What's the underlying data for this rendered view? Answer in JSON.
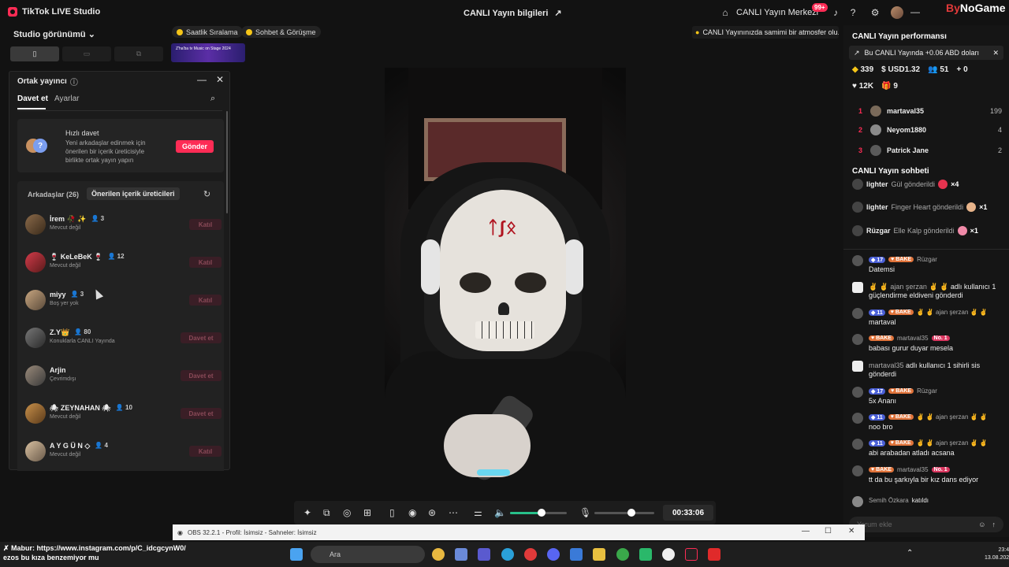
{
  "app": {
    "title": "TikTok LIVE Studio",
    "center_title": "CANLI Yayın bilgileri",
    "live_center": "CANLI Yayın Merkezi",
    "notif_badge": "99+"
  },
  "watermark": {
    "brand_by": "By",
    "brand_rest": "NoGame"
  },
  "studio": {
    "view_label": "Studio görünümü"
  },
  "pills": {
    "hourly": "Saatlik Sıralama",
    "chat": "Sohbet & Görüşme"
  },
  "banner": {
    "text": "Z'ha'ba tv Music on Stage 2024"
  },
  "tip": {
    "text": "CANLI Yayınınızda samimi bir atmosfer olu..."
  },
  "cohost": {
    "title": "Ortak yayıncı",
    "tabs": [
      "Davet et",
      "Ayarlar"
    ],
    "quick": {
      "title": "Hızlı davet",
      "desc": "Yeni arkadaşlar edinmek için önerilen bir içerik üreticisiyle birlikte ortak yayın yapın",
      "button": "Gönder"
    },
    "friends_tab": "Arkadaşlar (26)",
    "suggested_tab": "Önerilen içerik üreticileri",
    "rows": [
      {
        "name": "İrem 🥀 ✨",
        "count": "3",
        "status": "Mevcut değil",
        "button": "Katıl"
      },
      {
        "name": "🍷 KeLeBeK 🍷",
        "count": "12",
        "status": "Mevcut değil",
        "button": "Katıl"
      },
      {
        "name": "miyy",
        "count": "3",
        "status": "Boş yer yok",
        "button": "Katıl"
      },
      {
        "name": "Z.Y👑",
        "count": "80",
        "status": "Konuklarla CANLI Yayında",
        "button": "Davet et"
      },
      {
        "name": "Arjin",
        "count": "",
        "status": "Çevrimdışı",
        "button": "Davet et"
      },
      {
        "name": "🕷 ZEYNAHAN 🕷",
        "count": "10",
        "status": "Mevcut değil",
        "button": "Davet et"
      },
      {
        "name": "A Y G Ü N ◇",
        "count": "4",
        "status": "Mevcut değil",
        "button": "Katıl"
      }
    ]
  },
  "toolbar": {
    "timer": "00:33:06",
    "volume": 0.55,
    "mic": 0.62
  },
  "performance": {
    "title": "CANLI Yayın performansı",
    "earnings": "Bu CANLI Yayında +0.06 ABD doları",
    "coins": "339",
    "usd": "USD1.32",
    "viewers": "51",
    "new": "0",
    "likes": "12K",
    "gifts": "9",
    "ranks": [
      {
        "rank": "1",
        "name": "martaval35",
        "value": "199"
      },
      {
        "rank": "2",
        "name": "Neyom1880",
        "value": "4"
      },
      {
        "rank": "3",
        "name": "Patrick Jane",
        "value": "2"
      }
    ]
  },
  "chat": {
    "title": "CANLI Yayın sohbeti",
    "gifts": [
      {
        "user": "lighter",
        "text": "Gül gönderildi",
        "mult": "×4",
        "color": "#e5334f"
      },
      {
        "user": "lighter",
        "text": "Finger Heart gönderildi",
        "mult": "×1",
        "color": "#e8b48a"
      },
      {
        "user": "Rüzgar",
        "text": "Elle Kalp gönderildi",
        "mult": "×1",
        "color": "#f08aa8"
      }
    ],
    "messages": [
      {
        "lvl": "17",
        "bake": "BAKE",
        "user": "Rüzgar",
        "text": "Datemsi"
      },
      {
        "lvl": "",
        "bake": "",
        "user": "✌ ✌ ajan şerzan ✌ ✌",
        "text": "adlı kullanıcı 1 güçlendirme eldiveni gönderdi"
      },
      {
        "lvl": "11",
        "bake": "BAKE",
        "user": "✌ ✌ ajan şerzan ✌ ✌",
        "text": "martaval"
      },
      {
        "lvl": "",
        "bake": "BAKE",
        "user": "martaval35",
        "no1": "No. 1",
        "text": "babası gurur duyar mesela"
      },
      {
        "lvl": "",
        "bake": "",
        "user": "martaval35",
        "text": "adlı kullanıcı 1 sihirli sis gönderdi"
      },
      {
        "lvl": "17",
        "bake": "BAKE",
        "user": "Rüzgar",
        "text": "5x Ananı"
      },
      {
        "lvl": "11",
        "bake": "BAKE",
        "user": "✌ ✌ ajan şerzan ✌ ✌",
        "text": "noo bro"
      },
      {
        "lvl": "11",
        "bake": "BAKE",
        "user": "✌ ✌ ajan şerzan ✌ ✌",
        "text": "abi arabadan atladı acsana"
      },
      {
        "lvl": "",
        "bake": "BAKE",
        "user": "martaval35",
        "no1": "No. 1",
        "text": "tt da bu şarkıyla bir kız dans ediyor"
      },
      {
        "lvl": "",
        "bake": "",
        "user": "Semih Özkara",
        "text": "katıldı"
      }
    ],
    "comment_placeholder": "Yorum ekle"
  },
  "obs": {
    "title": "OBS 32.2.1 - Profil: İsimsiz - Sahneler: İsimsiz"
  },
  "overlay": {
    "line1": "✗ Mabur: https://www.instagram.com/p/C_idcgcynW0/",
    "line2": "ezos bu kıza benzemiyor mu"
  },
  "taskbar": {
    "search": "Ara",
    "time": "23:41",
    "date": "13.08.2026"
  }
}
